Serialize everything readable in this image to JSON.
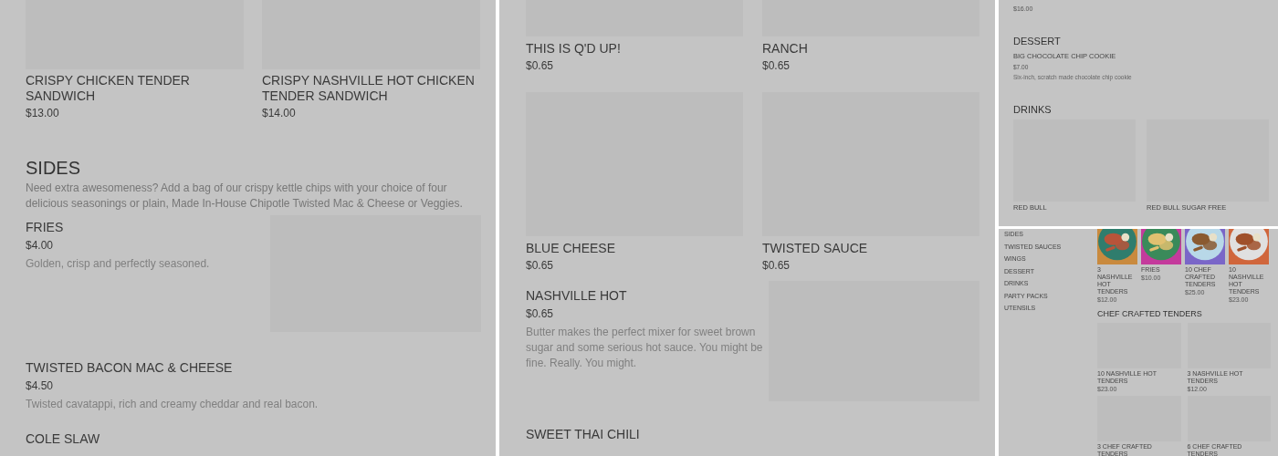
{
  "left_panel": {
    "cards": [
      {
        "name": "CRISPY CHICKEN TENDER SANDWICH",
        "price": "$13.00"
      },
      {
        "name": "CRISPY NASHVILLE HOT CHICKEN TENDER SANDWICH",
        "price": "$14.00"
      }
    ],
    "section": {
      "title": "SIDES",
      "description": "Need extra awesomeness? Add a bag of our crispy kettle chips with your choice of four delicious seasonings or plain, Made In-House Chipotle Twisted Mac & Cheese or Veggies.",
      "items": [
        {
          "kind": "with_image",
          "name": "FRIES",
          "price": "$4.00",
          "description": "Golden, crisp and perfectly seasoned."
        },
        {
          "kind": "text",
          "name": "TWISTED BACON MAC & CHEESE",
          "price": "$4.50",
          "description": "Twisted cavatappi, rich and creamy cheddar and real bacon."
        },
        {
          "kind": "text",
          "name": "COLE SLAW"
        }
      ]
    }
  },
  "middle_panel": {
    "card_rows": [
      [
        {
          "name": "THIS IS Q'D UP!",
          "price": "$0.65"
        },
        {
          "name": "RANCH",
          "price": "$0.65"
        }
      ],
      [
        {
          "name": "BLUE CHEESE",
          "price": "$0.65"
        },
        {
          "name": "TWISTED SAUCE",
          "price": "$0.65"
        }
      ]
    ],
    "items": [
      {
        "kind": "with_image",
        "name": "NASHVILLE HOT",
        "price": "$0.65",
        "description": "Butter makes the perfect mixer for sweet brown sugar and some serious hot sauce. You might be fine. Really. You might."
      },
      {
        "kind": "text",
        "name": "SWEET THAI CHILI"
      }
    ]
  },
  "top_right_panel": {
    "price": "$16.00",
    "sections": [
      {
        "title": "DESSERT",
        "items": [
          {
            "name": "BIG CHOCOLATE CHIP COOKIE",
            "price": "$7.00",
            "description": "Six-inch, scratch made chocolate chip cookie"
          }
        ]
      },
      {
        "title": "DRINKS",
        "cards": [
          {
            "name": "RED BULL"
          },
          {
            "name": "RED BULL SUGAR FREE"
          }
        ]
      }
    ]
  },
  "bottom_right_panel": {
    "nav": [
      "SIDES",
      "TWISTED SAUCES",
      "WINGS",
      "DESSERT",
      "DRINKS",
      "PARTY PACKS",
      "UTENSILS"
    ],
    "featured": [
      {
        "name": "3 NASHVILLE HOT TENDERS",
        "price": "$12.00"
      },
      {
        "name": "FRIES",
        "price": "$10.00"
      },
      {
        "name": "10 CHEF CRAFTED TENDERS",
        "price": "$25.00"
      },
      {
        "name": "10 NASHVILLE HOT TENDERS",
        "price": "$23.00"
      }
    ],
    "section": {
      "title": "CHEF CRAFTED TENDERS",
      "cards": [
        {
          "name": "10 NASHVILLE HOT TENDERS",
          "price": "$23.00"
        },
        {
          "name": "3 NASHVILLE HOT TENDERS",
          "price": "$12.00"
        },
        {
          "name": "3 CHEF CRAFTED TENDERS"
        },
        {
          "name": "6 CHEF CRAFTED TENDERS"
        }
      ]
    }
  }
}
